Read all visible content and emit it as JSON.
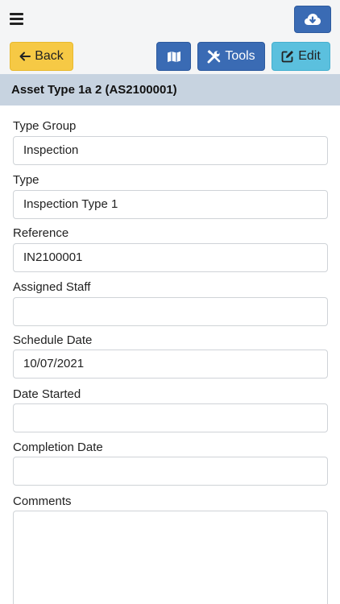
{
  "header": {
    "menu_icon": "hamburger-icon",
    "download_icon": "cloud-download-icon"
  },
  "toolbar": {
    "back_label": "Back",
    "map_icon": "map-icon",
    "tools_label": "Tools",
    "edit_label": "Edit"
  },
  "record": {
    "title": "Asset Type 1a 2 (AS2100001)"
  },
  "fields": [
    {
      "label": "Type Group",
      "value": "Inspection"
    },
    {
      "label": "Type",
      "value": "Inspection Type 1"
    },
    {
      "label": "Reference",
      "value": "IN2100001"
    },
    {
      "label": "Assigned Staff",
      "value": ""
    },
    {
      "label": "Schedule Date",
      "value": "10/07/2021"
    },
    {
      "label": "Date Started",
      "value": ""
    },
    {
      "label": "Completion Date",
      "value": ""
    },
    {
      "label": "Comments",
      "value": ""
    }
  ],
  "colors": {
    "primary": "#3a6bb4",
    "warning": "#f6c945",
    "info": "#5bc0de",
    "header_bg": "#c7d3e0"
  }
}
